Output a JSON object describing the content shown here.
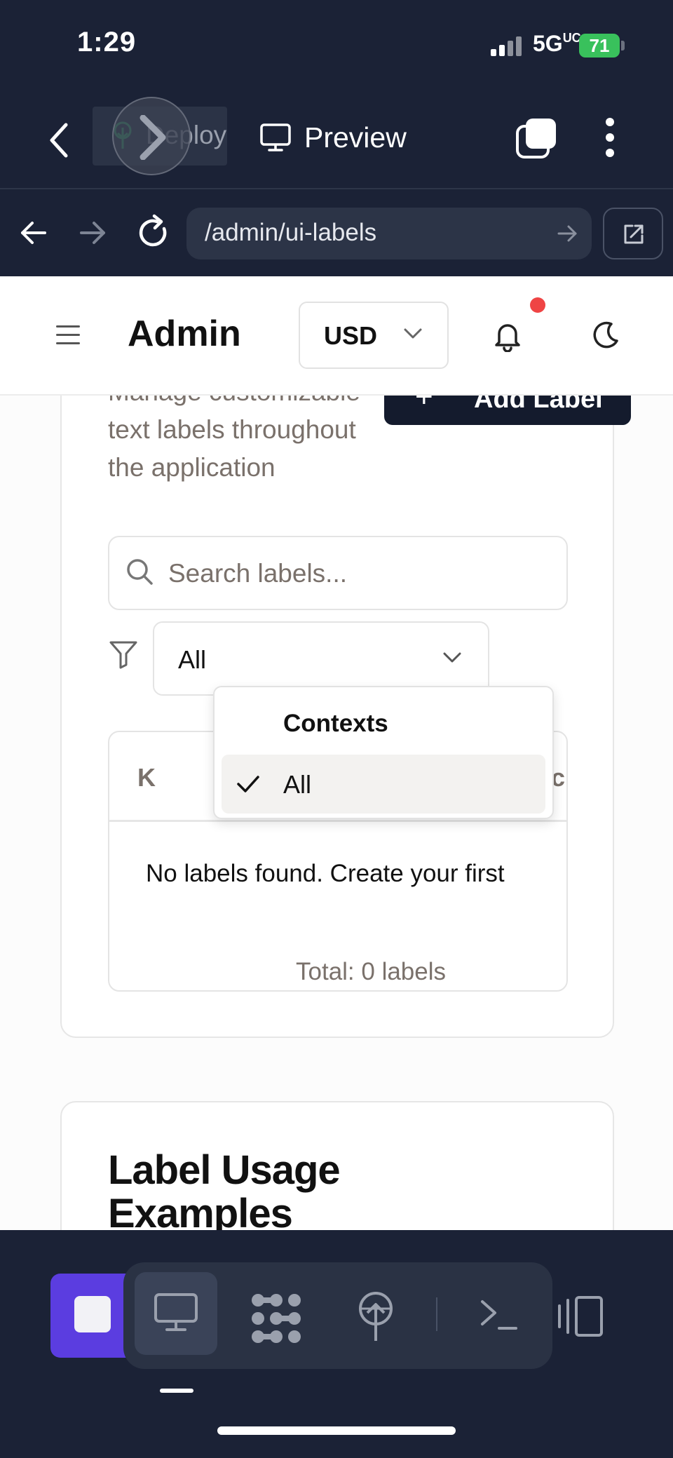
{
  "status_bar": {
    "time": "1:29",
    "network": "5G",
    "network_suffix": "UC",
    "battery": "71"
  },
  "app_toolbar": {
    "deploy_label": "Deploy",
    "preview_label": "Preview"
  },
  "browser": {
    "url": "/admin/ui-labels"
  },
  "header": {
    "brand": "Admin",
    "currency": "USD"
  },
  "labels_card": {
    "description": "Manage customizable text labels throughout the application",
    "add_button_label": "Add Label",
    "search_placeholder": "Search labels...",
    "filter_value": "All",
    "table": {
      "col_key": "K",
      "col_actions": "Ac",
      "empty_message": "No labels found. Create your first",
      "total": "Total: 0 labels"
    },
    "dropdown": {
      "title": "Contexts",
      "items": [
        {
          "label": "All",
          "selected": true
        }
      ]
    }
  },
  "usage_card": {
    "title": "Label Usage Examples"
  },
  "colors": {
    "app_bg": "#1b2236",
    "accent_stop": "#5b3de0",
    "primary_button": "#141b2d",
    "notification_dot": "#ef4444",
    "battery": "#39c15c"
  }
}
